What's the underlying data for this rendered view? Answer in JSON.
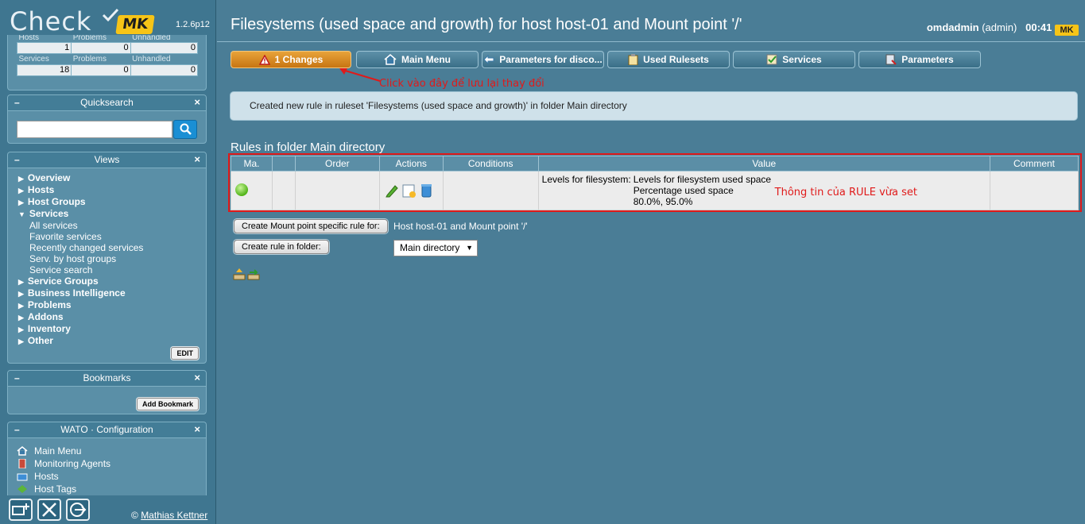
{
  "sidebar": {
    "logo_text": "Check",
    "logo_mk": "MK",
    "version": "1.2.6p12",
    "stats": {
      "hosts_label": "Hosts",
      "problems_label": "Problems",
      "unhandled_label": "Unhandled",
      "hosts_total": "1",
      "hosts_problems": "0",
      "hosts_unhandled": "0",
      "services_label": "Services",
      "services_total": "18",
      "services_problems": "0",
      "services_unhandled": "0"
    },
    "quicksearch": {
      "title": "Quicksearch",
      "placeholder": ""
    },
    "views": {
      "title": "Views",
      "items": [
        {
          "label": "Overview",
          "type": "top"
        },
        {
          "label": "Hosts",
          "type": "top"
        },
        {
          "label": "Host Groups",
          "type": "top"
        },
        {
          "label": "Services",
          "type": "open"
        },
        {
          "label": "All services",
          "type": "sub"
        },
        {
          "label": "Favorite services",
          "type": "sub"
        },
        {
          "label": "Recently changed services",
          "type": "sub"
        },
        {
          "label": "Serv. by host groups",
          "type": "sub"
        },
        {
          "label": "Service search",
          "type": "sub"
        },
        {
          "label": "Service Groups",
          "type": "top"
        },
        {
          "label": "Business Intelligence",
          "type": "top"
        },
        {
          "label": "Problems",
          "type": "top"
        },
        {
          "label": "Addons",
          "type": "top"
        },
        {
          "label": "Inventory",
          "type": "top"
        },
        {
          "label": "Other",
          "type": "top"
        }
      ],
      "edit_label": "EDIT"
    },
    "bookmarks": {
      "title": "Bookmarks",
      "add_label": "Add Bookmark"
    },
    "wato": {
      "title": "WATO · Configuration",
      "items": [
        "Main Menu",
        "Monitoring Agents",
        "Hosts",
        "Host Tags"
      ]
    },
    "footer": {
      "copyright": "©",
      "author": "Mathias Kettner"
    }
  },
  "header": {
    "title": "Filesystems (used space and growth) for host host-01 and Mount point '/'",
    "user": "omdadmin",
    "role": "(admin)",
    "time": "00:41",
    "mk": "MK"
  },
  "toolbar": {
    "changes": "1 Changes",
    "main_menu": "Main Menu",
    "parameters_disco": "Parameters for disco...",
    "used_rulesets": "Used Rulesets",
    "services": "Services",
    "parameters": "Parameters"
  },
  "annotations": {
    "click_note": "Click vào đây để lưu lại thay đổi",
    "rule_note": "Thông tin của RULE vừa set"
  },
  "message": "Created new rule in ruleset 'Filesystems (used space and growth)' in folder Main directory",
  "rules": {
    "title": "Rules in folder Main directory",
    "columns": [
      "Ma.",
      "",
      "Order",
      "Actions",
      "Conditions",
      "Value",
      "Comment"
    ],
    "row": {
      "value_key": "Levels for filesystem:",
      "value_line1": "Levels for filesystem used space",
      "value_line2": "Percentage used space",
      "value_line3": "80.0%, 95.0%",
      "comment": ""
    }
  },
  "actions": {
    "create_specific": "Create Mount point specific rule for:",
    "host_label": "Host host-01 and Mount point '/'",
    "create_in_folder": "Create rule in folder:",
    "folder_selected": "Main directory"
  },
  "colors": {
    "accent": "#4a7d96",
    "changes": "#d98a1f",
    "annotation": "#e01a1a",
    "ok": "#50b317"
  }
}
